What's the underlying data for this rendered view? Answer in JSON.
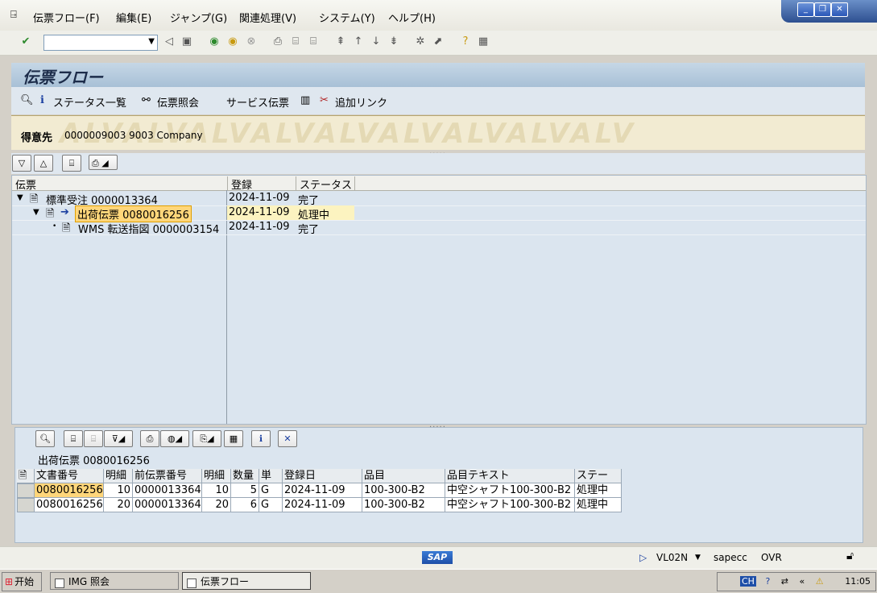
{
  "menubar": {
    "items": [
      "伝票フロー(F)",
      "編集(E)",
      "ジャンプ(G)",
      "関連処理(V)",
      "システム(Y)",
      "ヘルプ(H)"
    ]
  },
  "toolbar": {
    "command_value": ""
  },
  "title": "伝票フロー",
  "app_toolbar": {
    "status_overview": "ステータス一覧",
    "doc_display": "伝票照会",
    "service_doc": "サービス伝票",
    "additional_links": "追加リンク"
  },
  "header": {
    "label": "得意先",
    "value": "0000009003 9003 Company",
    "watermark": "ALVALVALVALVALVALVALVALVALV"
  },
  "tree": {
    "columns": [
      "伝票",
      "登録",
      "ステータス"
    ],
    "rows": [
      {
        "doc": "標準受注 0000013364",
        "date": "2024-11-09",
        "status": "完了"
      },
      {
        "doc": "出荷伝票 0080016256",
        "date": "2024-11-09",
        "status": "処理中"
      },
      {
        "doc": "WMS 転送指図 0000003154",
        "date": "2024-11-09",
        "status": "完了"
      }
    ]
  },
  "list": {
    "title": "出荷伝票 0080016256",
    "columns": [
      "文書番号",
      "明細",
      "前伝票番号",
      "明細",
      "数量",
      "単",
      "登録日",
      "品目",
      "品目テキスト",
      "ステー"
    ],
    "rows": [
      [
        "0080016256",
        "10",
        "0000013364",
        "10",
        "5",
        "G",
        "2024-11-09",
        "100-300-B2",
        "中空シャフト100-300-B2",
        "処理中"
      ],
      [
        "0080016256",
        "20",
        "0000013364",
        "20",
        "6",
        "G",
        "2024-11-09",
        "100-300-B2",
        "中空シャフト100-300-B2",
        "処理中"
      ]
    ]
  },
  "statusbar": {
    "logo": "SAP",
    "transaction": "VL02N",
    "system": "sapecc",
    "mode": "OVR"
  },
  "taskbar": {
    "start": "开始",
    "tasks": [
      "IMG 照会",
      "伝票フロー"
    ],
    "tray_text": "CH",
    "clock": "11:05"
  }
}
